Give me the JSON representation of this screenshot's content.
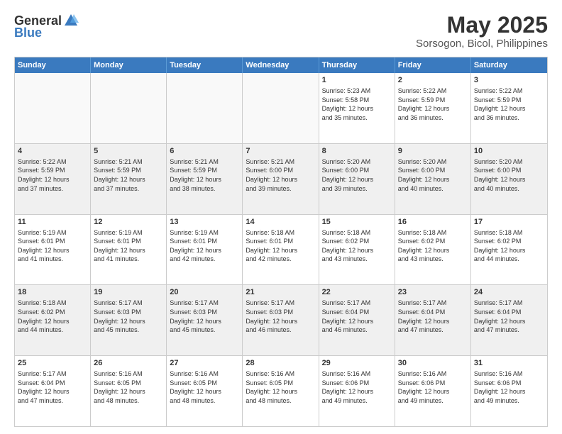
{
  "logo": {
    "general": "General",
    "blue": "Blue"
  },
  "title": "May 2025",
  "subtitle": "Sorsogon, Bicol, Philippines",
  "days": [
    "Sunday",
    "Monday",
    "Tuesday",
    "Wednesday",
    "Thursday",
    "Friday",
    "Saturday"
  ],
  "weeks": [
    [
      {
        "day": "",
        "info": ""
      },
      {
        "day": "",
        "info": ""
      },
      {
        "day": "",
        "info": ""
      },
      {
        "day": "",
        "info": ""
      },
      {
        "day": "1",
        "info": "Sunrise: 5:23 AM\nSunset: 5:58 PM\nDaylight: 12 hours\nand 35 minutes."
      },
      {
        "day": "2",
        "info": "Sunrise: 5:22 AM\nSunset: 5:59 PM\nDaylight: 12 hours\nand 36 minutes."
      },
      {
        "day": "3",
        "info": "Sunrise: 5:22 AM\nSunset: 5:59 PM\nDaylight: 12 hours\nand 36 minutes."
      }
    ],
    [
      {
        "day": "4",
        "info": "Sunrise: 5:22 AM\nSunset: 5:59 PM\nDaylight: 12 hours\nand 37 minutes."
      },
      {
        "day": "5",
        "info": "Sunrise: 5:21 AM\nSunset: 5:59 PM\nDaylight: 12 hours\nand 37 minutes."
      },
      {
        "day": "6",
        "info": "Sunrise: 5:21 AM\nSunset: 5:59 PM\nDaylight: 12 hours\nand 38 minutes."
      },
      {
        "day": "7",
        "info": "Sunrise: 5:21 AM\nSunset: 6:00 PM\nDaylight: 12 hours\nand 39 minutes."
      },
      {
        "day": "8",
        "info": "Sunrise: 5:20 AM\nSunset: 6:00 PM\nDaylight: 12 hours\nand 39 minutes."
      },
      {
        "day": "9",
        "info": "Sunrise: 5:20 AM\nSunset: 6:00 PM\nDaylight: 12 hours\nand 40 minutes."
      },
      {
        "day": "10",
        "info": "Sunrise: 5:20 AM\nSunset: 6:00 PM\nDaylight: 12 hours\nand 40 minutes."
      }
    ],
    [
      {
        "day": "11",
        "info": "Sunrise: 5:19 AM\nSunset: 6:01 PM\nDaylight: 12 hours\nand 41 minutes."
      },
      {
        "day": "12",
        "info": "Sunrise: 5:19 AM\nSunset: 6:01 PM\nDaylight: 12 hours\nand 41 minutes."
      },
      {
        "day": "13",
        "info": "Sunrise: 5:19 AM\nSunset: 6:01 PM\nDaylight: 12 hours\nand 42 minutes."
      },
      {
        "day": "14",
        "info": "Sunrise: 5:18 AM\nSunset: 6:01 PM\nDaylight: 12 hours\nand 42 minutes."
      },
      {
        "day": "15",
        "info": "Sunrise: 5:18 AM\nSunset: 6:02 PM\nDaylight: 12 hours\nand 43 minutes."
      },
      {
        "day": "16",
        "info": "Sunrise: 5:18 AM\nSunset: 6:02 PM\nDaylight: 12 hours\nand 43 minutes."
      },
      {
        "day": "17",
        "info": "Sunrise: 5:18 AM\nSunset: 6:02 PM\nDaylight: 12 hours\nand 44 minutes."
      }
    ],
    [
      {
        "day": "18",
        "info": "Sunrise: 5:18 AM\nSunset: 6:02 PM\nDaylight: 12 hours\nand 44 minutes."
      },
      {
        "day": "19",
        "info": "Sunrise: 5:17 AM\nSunset: 6:03 PM\nDaylight: 12 hours\nand 45 minutes."
      },
      {
        "day": "20",
        "info": "Sunrise: 5:17 AM\nSunset: 6:03 PM\nDaylight: 12 hours\nand 45 minutes."
      },
      {
        "day": "21",
        "info": "Sunrise: 5:17 AM\nSunset: 6:03 PM\nDaylight: 12 hours\nand 46 minutes."
      },
      {
        "day": "22",
        "info": "Sunrise: 5:17 AM\nSunset: 6:04 PM\nDaylight: 12 hours\nand 46 minutes."
      },
      {
        "day": "23",
        "info": "Sunrise: 5:17 AM\nSunset: 6:04 PM\nDaylight: 12 hours\nand 47 minutes."
      },
      {
        "day": "24",
        "info": "Sunrise: 5:17 AM\nSunset: 6:04 PM\nDaylight: 12 hours\nand 47 minutes."
      }
    ],
    [
      {
        "day": "25",
        "info": "Sunrise: 5:17 AM\nSunset: 6:04 PM\nDaylight: 12 hours\nand 47 minutes."
      },
      {
        "day": "26",
        "info": "Sunrise: 5:16 AM\nSunset: 6:05 PM\nDaylight: 12 hours\nand 48 minutes."
      },
      {
        "day": "27",
        "info": "Sunrise: 5:16 AM\nSunset: 6:05 PM\nDaylight: 12 hours\nand 48 minutes."
      },
      {
        "day": "28",
        "info": "Sunrise: 5:16 AM\nSunset: 6:05 PM\nDaylight: 12 hours\nand 48 minutes."
      },
      {
        "day": "29",
        "info": "Sunrise: 5:16 AM\nSunset: 6:06 PM\nDaylight: 12 hours\nand 49 minutes."
      },
      {
        "day": "30",
        "info": "Sunrise: 5:16 AM\nSunset: 6:06 PM\nDaylight: 12 hours\nand 49 minutes."
      },
      {
        "day": "31",
        "info": "Sunrise: 5:16 AM\nSunset: 6:06 PM\nDaylight: 12 hours\nand 49 minutes."
      }
    ]
  ]
}
